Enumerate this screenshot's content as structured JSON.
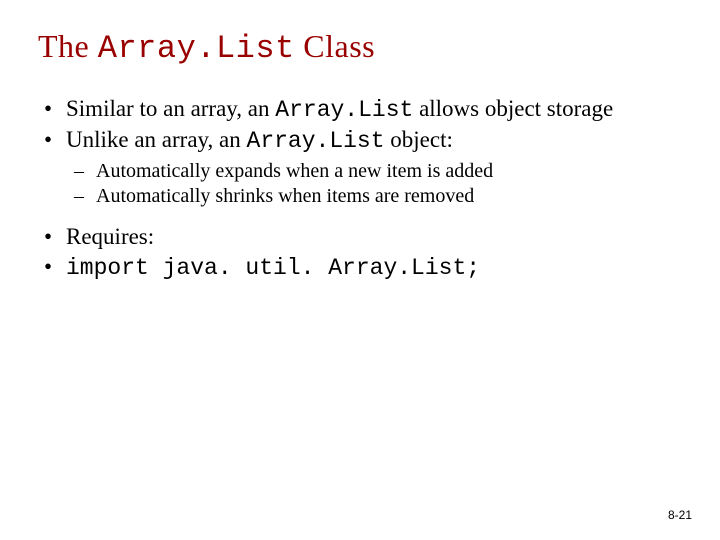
{
  "title": {
    "pre": "The ",
    "code": "Array.List",
    "post": " Class"
  },
  "bullets": {
    "b1a": "Similar to an array, an ",
    "b1code": "Array.List",
    "b1b": " allows object storage",
    "b2a": "Unlike an array, an ",
    "b2code": "Array.List",
    "b2b": " object:",
    "s1": "Automatically expands when a new item is added",
    "s2": "Automatically shrinks when items are removed",
    "b3": "Requires:",
    "b4": "import java. util. Array.List;"
  },
  "page": "8-21"
}
